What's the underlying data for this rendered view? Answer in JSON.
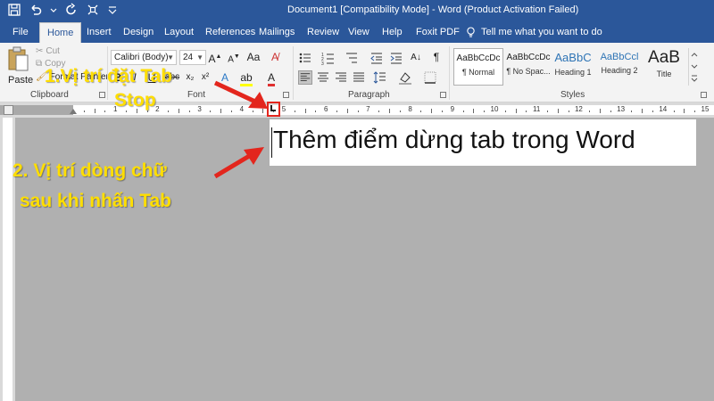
{
  "window": {
    "title": "Document1 [Compatibility Mode]  -  Word (Product Activation Failed)"
  },
  "tabs": {
    "file": "File",
    "home": "Home",
    "insert": "Insert",
    "design": "Design",
    "layout": "Layout",
    "references": "References",
    "mailings": "Mailings",
    "review": "Review",
    "view": "View",
    "help": "Help",
    "foxit": "Foxit PDF",
    "tell_me": "Tell me what you want to do"
  },
  "clipboard": {
    "paste": "Paste",
    "cut": "Cut",
    "copy": "Copy",
    "format_painter": "Format Painter",
    "label": "Clipboard"
  },
  "font": {
    "name": "Calibri (Body)",
    "size": "24",
    "label": "Font"
  },
  "paragraph": {
    "label": "Paragraph"
  },
  "styles": {
    "label": "Styles",
    "items": [
      {
        "preview": "AaBbCcDc",
        "name": "¶ Normal"
      },
      {
        "preview": "AaBbCcDc",
        "name": "¶ No Spac..."
      },
      {
        "preview": "AaBbC",
        "name": "Heading 1"
      },
      {
        "preview": "AaBbCcl",
        "name": "Heading 2"
      },
      {
        "preview": "AaB",
        "name": "Title"
      }
    ]
  },
  "ruler": {
    "numbers": [
      "1",
      "2",
      "3",
      "4",
      "5",
      "6",
      "7",
      "8",
      "9",
      "10",
      "11",
      "12",
      "13",
      "14",
      "15"
    ]
  },
  "document": {
    "text": "Thêm điểm dừng tab trong Word"
  },
  "annotations": {
    "tab_stop_line1": "1.Vị trí đặt Tab",
    "tab_stop_line2": "Stop",
    "text_pos_line1": "2. Vị trí dòng chữ",
    "text_pos_line2": "sau khi nhấn Tab"
  },
  "colors": {
    "accent": "#2b579a",
    "annotation": "#ffde00",
    "arrow": "#e3261d"
  }
}
